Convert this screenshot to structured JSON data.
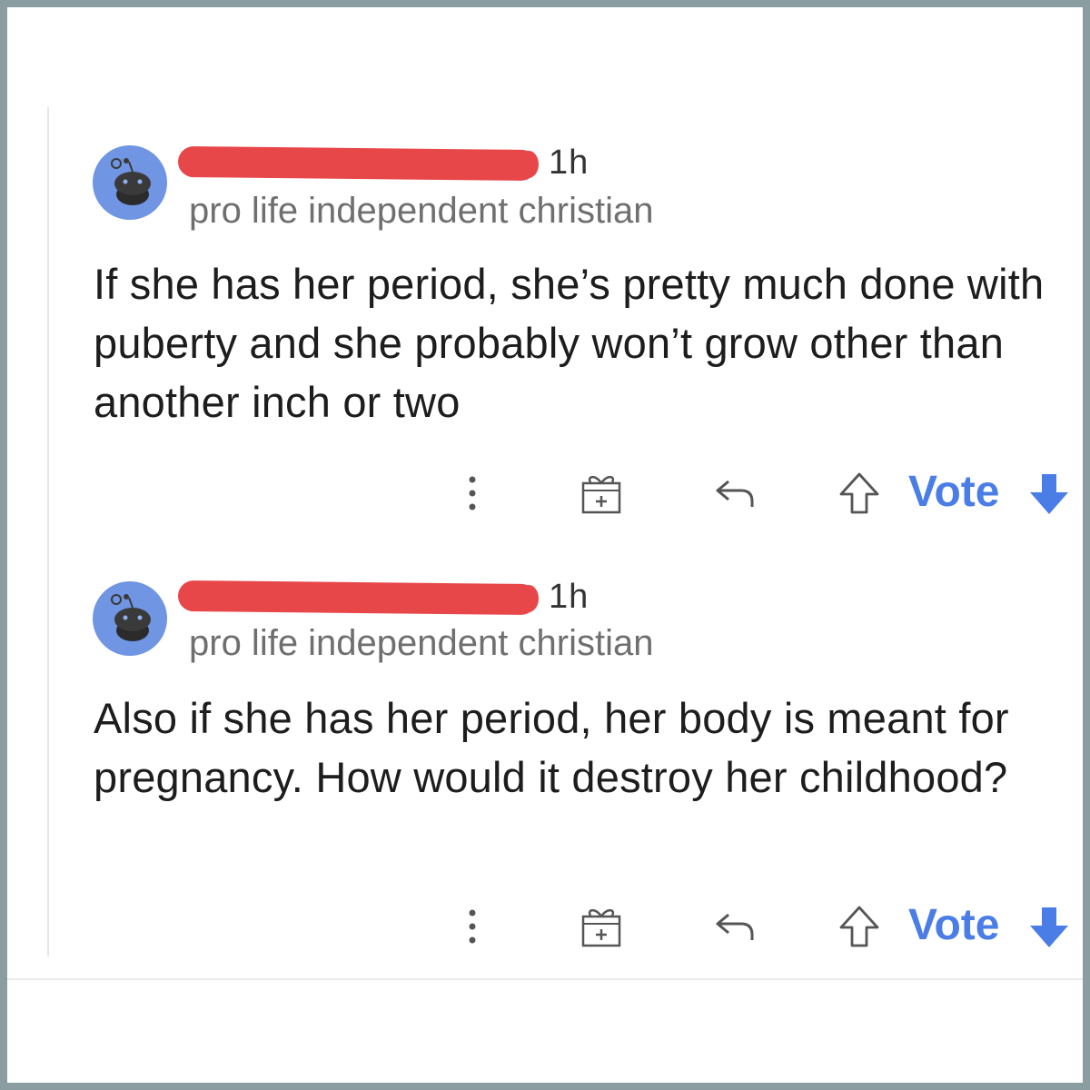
{
  "comments": [
    {
      "time": "1h",
      "flair": "pro life independent christian",
      "body": "If she has her period, she’s pretty much done with puberty and she probably won’t grow other than another inch or two",
      "vote_label": "Vote"
    },
    {
      "time": "1h",
      "flair": "pro life independent christian",
      "body": "Also if she has her period, her body is meant for pregnancy. How would it destroy her childhood?",
      "vote_label": "Vote"
    }
  ],
  "colors": {
    "vote_accent": "#4a7ee6",
    "redaction": "#e8474a",
    "avatar_bg": "#6f95e3",
    "frame": "#8a9ea2"
  },
  "icons": [
    "snoo-avatar-icon",
    "more-options-icon",
    "award-icon",
    "reply-icon",
    "upvote-icon",
    "downvote-icon"
  ]
}
